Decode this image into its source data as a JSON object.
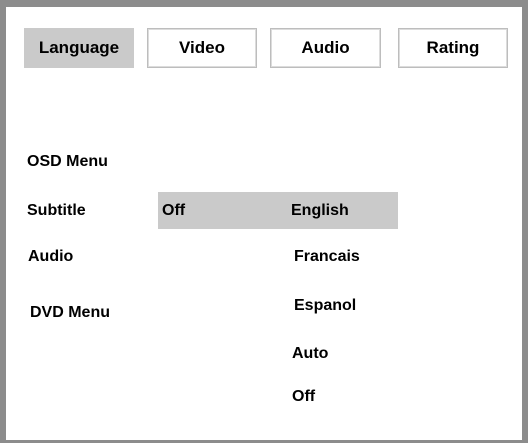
{
  "tabs": [
    {
      "label": "Language",
      "active": true
    },
    {
      "label": "Video",
      "active": false
    },
    {
      "label": "Audio",
      "active": false
    },
    {
      "label": "Rating",
      "active": false
    }
  ],
  "menu_items": [
    {
      "label": "OSD Menu"
    },
    {
      "label": "Subtitle",
      "selected": true
    },
    {
      "label": "Audio"
    },
    {
      "label": "DVD Menu"
    }
  ],
  "subtitle_current_value": "Off",
  "subtitle_options": [
    "English",
    "Francais",
    "Espanol",
    "Auto",
    "Off"
  ],
  "colors": {
    "frame": "#8c8c8c",
    "highlight": "#cacaca",
    "text": "#000000"
  }
}
